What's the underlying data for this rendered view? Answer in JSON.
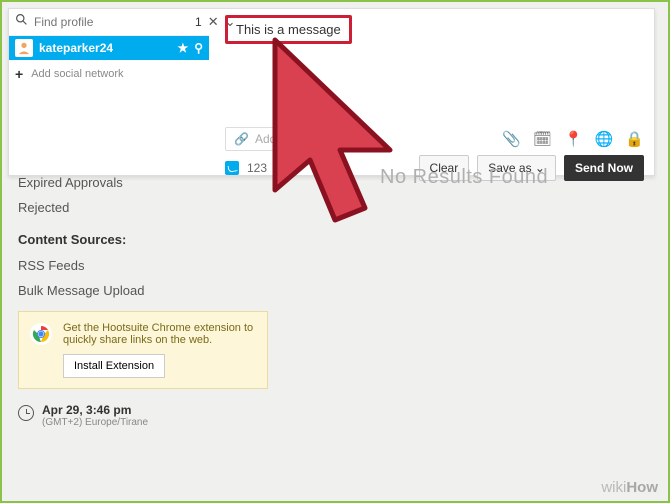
{
  "composer": {
    "search_placeholder": "Find profile",
    "profile_count": "1",
    "selected_profile": "kateparker24",
    "add_network_label": "Add social network",
    "message_text": "This is a message",
    "link_placeholder": "Add a link",
    "char_count": "123",
    "buttons": {
      "clear": "Clear",
      "save_as": "Save as",
      "send_now": "Send Now"
    }
  },
  "sidebar": {
    "items": [
      "Expired Approvals",
      "Rejected"
    ],
    "content_sources_heading": "Content Sources:",
    "content_sources": [
      "RSS Feeds",
      "Bulk Message Upload"
    ],
    "promo": {
      "text": "Get the Hootsuite Chrome extension to quickly share links on the web.",
      "button": "Install Extension"
    },
    "timezone": {
      "date": "Apr 29, 3:46 pm",
      "zone": "(GMT+2) Europe/Tirane"
    }
  },
  "main": {
    "no_results": "No Results Found"
  },
  "watermark": {
    "prefix": "wiki",
    "suffix": "How"
  }
}
